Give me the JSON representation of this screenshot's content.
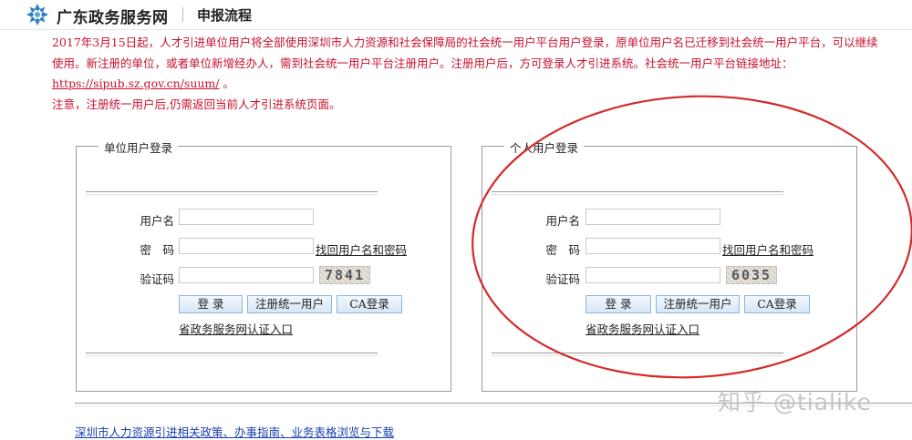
{
  "header": {
    "brand": "广东政务服务网",
    "page_tag": "申报流程"
  },
  "notice": {
    "line1": "2017年3月15日起，人才引进单位用户将全部使用深圳市人力资源和社会保障局的社会统一用户平台用户登录，原单位用户名已迁移到社会统一用户平台，可以继续使用。新注册的单位，或者单位新增经办人，需到社会统一用户平台注册用户。注册用户后，方可登录人才引进系统。社会统一用户平台链接地址：",
    "link": "https://sipub.sz.gov.cn/suum/",
    "line1_end": " 。",
    "line2": "注意，注册统一用户后,仍需返回当前人才引进系统页面。"
  },
  "unit_login": {
    "legend": "单位用户登录",
    "username_label": "用户名",
    "password_label": "密　码",
    "captcha_label": "验证码",
    "find_link": "找回用户名和密码",
    "captcha_text": "7841",
    "login_button": "登 录",
    "register_button": "注册统一用户",
    "ca_button": "CA登录",
    "gov_link": "省政务服务网认证入口"
  },
  "personal_login": {
    "legend": "个人用户登录",
    "username_label": "用户名",
    "password_label": "密　码",
    "captcha_label": "验证码",
    "find_link": "找回用户名和密码",
    "captcha_text": "6035",
    "login_button": "登 录",
    "register_button": "注册统一用户",
    "ca_button": "CA登录",
    "gov_link": "省政务服务网认证入口"
  },
  "footer": {
    "link": "深圳市人力资源引进相关政策、办事指南、业务表格浏览与下载"
  },
  "overlay": {
    "watermark": "知乎 @tialike",
    "annotation_color": "#d42a2a"
  },
  "colors": {
    "notice_red": "#c8102e",
    "footer_link_blue": "#1a3fb0",
    "button_border": "#8fb6d9"
  }
}
